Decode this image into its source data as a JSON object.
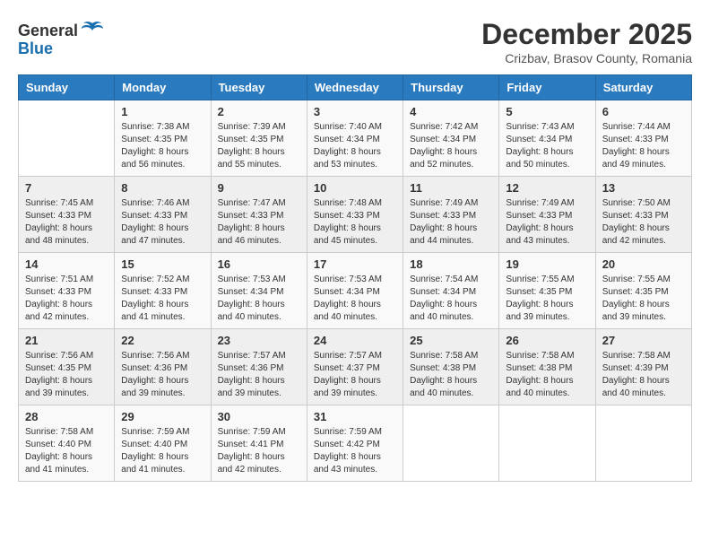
{
  "logo": {
    "general": "General",
    "blue": "Blue"
  },
  "title": "December 2025",
  "location": "Crizbav, Brasov County, Romania",
  "weekdays": [
    "Sunday",
    "Monday",
    "Tuesday",
    "Wednesday",
    "Thursday",
    "Friday",
    "Saturday"
  ],
  "weeks": [
    [
      {
        "day": "",
        "info": ""
      },
      {
        "day": "1",
        "info": "Sunrise: 7:38 AM\nSunset: 4:35 PM\nDaylight: 8 hours\nand 56 minutes."
      },
      {
        "day": "2",
        "info": "Sunrise: 7:39 AM\nSunset: 4:35 PM\nDaylight: 8 hours\nand 55 minutes."
      },
      {
        "day": "3",
        "info": "Sunrise: 7:40 AM\nSunset: 4:34 PM\nDaylight: 8 hours\nand 53 minutes."
      },
      {
        "day": "4",
        "info": "Sunrise: 7:42 AM\nSunset: 4:34 PM\nDaylight: 8 hours\nand 52 minutes."
      },
      {
        "day": "5",
        "info": "Sunrise: 7:43 AM\nSunset: 4:34 PM\nDaylight: 8 hours\nand 50 minutes."
      },
      {
        "day": "6",
        "info": "Sunrise: 7:44 AM\nSunset: 4:33 PM\nDaylight: 8 hours\nand 49 minutes."
      }
    ],
    [
      {
        "day": "7",
        "info": "Sunrise: 7:45 AM\nSunset: 4:33 PM\nDaylight: 8 hours\nand 48 minutes."
      },
      {
        "day": "8",
        "info": "Sunrise: 7:46 AM\nSunset: 4:33 PM\nDaylight: 8 hours\nand 47 minutes."
      },
      {
        "day": "9",
        "info": "Sunrise: 7:47 AM\nSunset: 4:33 PM\nDaylight: 8 hours\nand 46 minutes."
      },
      {
        "day": "10",
        "info": "Sunrise: 7:48 AM\nSunset: 4:33 PM\nDaylight: 8 hours\nand 45 minutes."
      },
      {
        "day": "11",
        "info": "Sunrise: 7:49 AM\nSunset: 4:33 PM\nDaylight: 8 hours\nand 44 minutes."
      },
      {
        "day": "12",
        "info": "Sunrise: 7:49 AM\nSunset: 4:33 PM\nDaylight: 8 hours\nand 43 minutes."
      },
      {
        "day": "13",
        "info": "Sunrise: 7:50 AM\nSunset: 4:33 PM\nDaylight: 8 hours\nand 42 minutes."
      }
    ],
    [
      {
        "day": "14",
        "info": "Sunrise: 7:51 AM\nSunset: 4:33 PM\nDaylight: 8 hours\nand 42 minutes."
      },
      {
        "day": "15",
        "info": "Sunrise: 7:52 AM\nSunset: 4:33 PM\nDaylight: 8 hours\nand 41 minutes."
      },
      {
        "day": "16",
        "info": "Sunrise: 7:53 AM\nSunset: 4:34 PM\nDaylight: 8 hours\nand 40 minutes."
      },
      {
        "day": "17",
        "info": "Sunrise: 7:53 AM\nSunset: 4:34 PM\nDaylight: 8 hours\nand 40 minutes."
      },
      {
        "day": "18",
        "info": "Sunrise: 7:54 AM\nSunset: 4:34 PM\nDaylight: 8 hours\nand 40 minutes."
      },
      {
        "day": "19",
        "info": "Sunrise: 7:55 AM\nSunset: 4:35 PM\nDaylight: 8 hours\nand 39 minutes."
      },
      {
        "day": "20",
        "info": "Sunrise: 7:55 AM\nSunset: 4:35 PM\nDaylight: 8 hours\nand 39 minutes."
      }
    ],
    [
      {
        "day": "21",
        "info": "Sunrise: 7:56 AM\nSunset: 4:35 PM\nDaylight: 8 hours\nand 39 minutes."
      },
      {
        "day": "22",
        "info": "Sunrise: 7:56 AM\nSunset: 4:36 PM\nDaylight: 8 hours\nand 39 minutes."
      },
      {
        "day": "23",
        "info": "Sunrise: 7:57 AM\nSunset: 4:36 PM\nDaylight: 8 hours\nand 39 minutes."
      },
      {
        "day": "24",
        "info": "Sunrise: 7:57 AM\nSunset: 4:37 PM\nDaylight: 8 hours\nand 39 minutes."
      },
      {
        "day": "25",
        "info": "Sunrise: 7:58 AM\nSunset: 4:38 PM\nDaylight: 8 hours\nand 40 minutes."
      },
      {
        "day": "26",
        "info": "Sunrise: 7:58 AM\nSunset: 4:38 PM\nDaylight: 8 hours\nand 40 minutes."
      },
      {
        "day": "27",
        "info": "Sunrise: 7:58 AM\nSunset: 4:39 PM\nDaylight: 8 hours\nand 40 minutes."
      }
    ],
    [
      {
        "day": "28",
        "info": "Sunrise: 7:58 AM\nSunset: 4:40 PM\nDaylight: 8 hours\nand 41 minutes."
      },
      {
        "day": "29",
        "info": "Sunrise: 7:59 AM\nSunset: 4:40 PM\nDaylight: 8 hours\nand 41 minutes."
      },
      {
        "day": "30",
        "info": "Sunrise: 7:59 AM\nSunset: 4:41 PM\nDaylight: 8 hours\nand 42 minutes."
      },
      {
        "day": "31",
        "info": "Sunrise: 7:59 AM\nSunset: 4:42 PM\nDaylight: 8 hours\nand 43 minutes."
      },
      {
        "day": "",
        "info": ""
      },
      {
        "day": "",
        "info": ""
      },
      {
        "day": "",
        "info": ""
      }
    ]
  ]
}
